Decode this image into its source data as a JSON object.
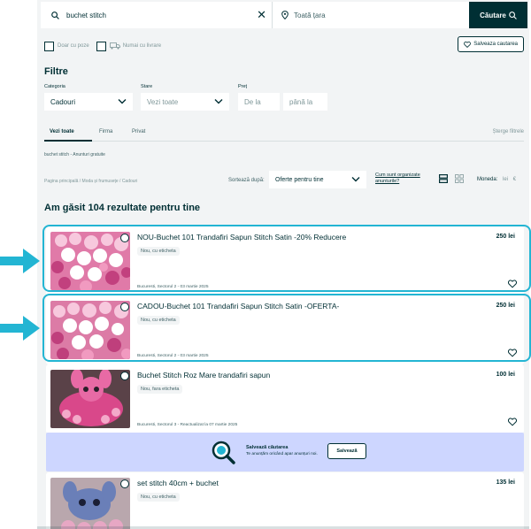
{
  "search": {
    "query": "buchet stitch",
    "location": "Toată țara",
    "button_label": "Căutare"
  },
  "options": {
    "photos_only": "Doar cu poze",
    "with_delivery": "Numai cu livrare",
    "save_search": "Salveaza cautarea"
  },
  "filters": {
    "title": "Filtre",
    "category_label": "Categoria",
    "category_value": "Cadouri",
    "condition_label": "Stare",
    "condition_value": "Vezi toate",
    "price_label": "Preț",
    "price_from": "De la",
    "price_to": "până la"
  },
  "tabs": [
    {
      "label": "Vezi toate"
    },
    {
      "label": "Firma"
    },
    {
      "label": "Privat"
    }
  ],
  "clear_filters": "Șterge filtrele",
  "breadcrumb_top": "buchet stitch - Anunturi gratuite",
  "breadcrumb_path": "Pagina principală / Moda și frumusețe / Cadouri",
  "sort": {
    "label": "Sortează după:",
    "value": "Oferte pentru tine",
    "how_link": "Cum sunt organizate anunturile?"
  },
  "currency": {
    "label": "Moneda:",
    "option1": "lei",
    "option2": "€"
  },
  "results_title": "Am găsit 104 rezultate pentru tine",
  "listings": [
    {
      "title": "NOU-Buchet 101 Trandafiri Sapun Stitch Satin -20% Reducere",
      "condition": "Nou, cu eticheta",
      "location": "Bucuresti, Sectorul 2 - 03 martie 2025",
      "price": "250 lei"
    },
    {
      "title": "CADOU-Buchet 101 Trandafiri Sapun Stitch Satin -OFERTA-",
      "condition": "Nou, cu eticheta",
      "location": "Bucuresti, Sectorul 2 - 03 martie 2025",
      "price": "250 lei"
    },
    {
      "title": "Buchet Stitch Roz Mare trandafiri sapun",
      "condition": "Nou, fara eticheta",
      "location": "Bucuresti, Sectorul 3 - Reactualizat la 07 martie 2025",
      "price": "100 lei"
    },
    {
      "title": "set stitch 40cm + buchet",
      "condition": "Nou, cu eticheta",
      "location": "",
      "price": "135 lei"
    }
  ],
  "banner": {
    "title": "Salvează căutarea",
    "subtitle": "Te anunțăm oricând apar anunțuri noi.",
    "button": "Salvează"
  },
  "colors": {
    "brand_dark": "#002f34",
    "page_bg": "#f2f4f5",
    "highlight": "#23b5d3",
    "banner_bg": "#cdd6ff"
  }
}
